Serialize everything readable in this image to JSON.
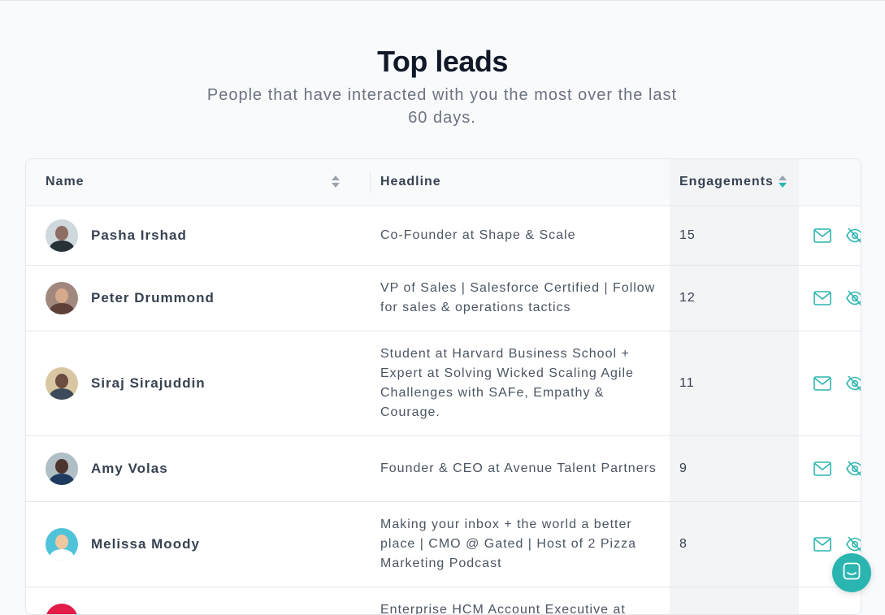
{
  "page": {
    "title": "Top leads",
    "subtitle": "People that have interacted with you the most over the last 60 days."
  },
  "table": {
    "columns": {
      "name": "Name",
      "headline": "Headline",
      "engagements": "Engagements"
    },
    "sort": {
      "column": "engagements",
      "direction": "descending"
    },
    "rows": [
      {
        "name": "Pasha Irshad",
        "headline": "Co-Founder at Shape & Scale",
        "engagements": "15"
      },
      {
        "name": "Peter Drummond",
        "headline": "VP of Sales | Salesforce Certified | Follow for sales & operations tactics",
        "engagements": "12"
      },
      {
        "name": "Siraj Sirajuddin",
        "headline": "Student at Harvard Business School + Expert at Solving Wicked Scaling Agile Challenges with SAFe, Empathy & Courage.",
        "engagements": "11"
      },
      {
        "name": "Amy Volas",
        "headline": "Founder & CEO at Avenue Talent Partners",
        "engagements": "9"
      },
      {
        "name": "Melissa Moody",
        "headline": "Making your inbox + the world a better place | CMO @ Gated | Host of 2 Pizza Marketing Podcast",
        "engagements": "8"
      },
      {
        "name": "",
        "headline": "Enterprise HCM Account Executive at",
        "engagements": ""
      }
    ],
    "row_actions": [
      "mail-icon",
      "hide-icon"
    ]
  },
  "colors": {
    "accent": "#2bb5b0",
    "title": "#111827",
    "muted": "#6b7280",
    "sorted_column_bg": "#f3f4f6"
  },
  "icons": {
    "chat_launcher": "chat-icon"
  }
}
